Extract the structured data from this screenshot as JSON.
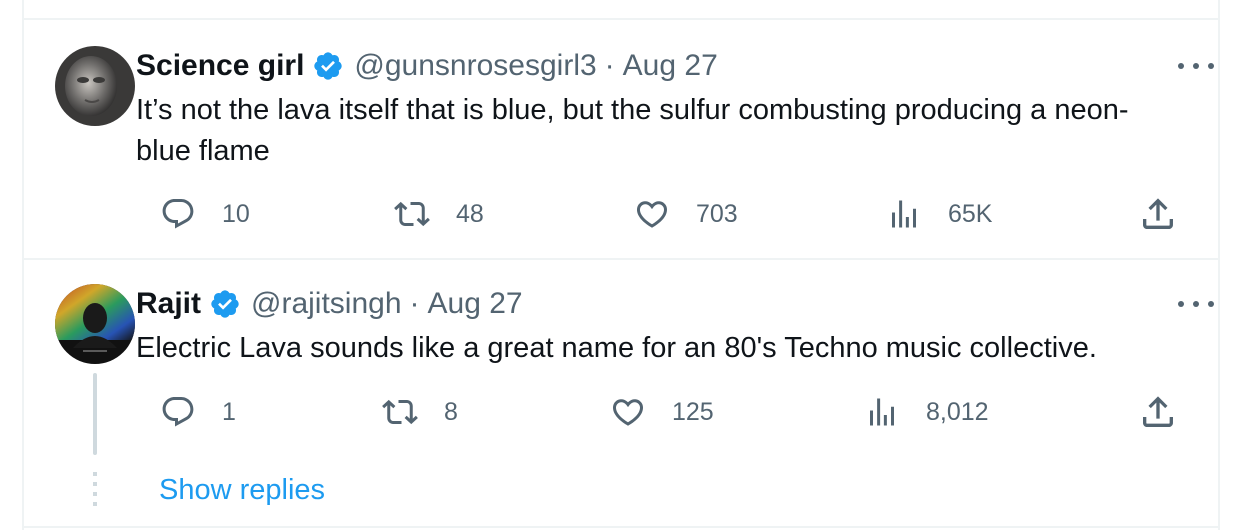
{
  "colors": {
    "accent": "#1d9bf0",
    "text_primary": "#0f1419",
    "text_secondary": "#536471",
    "divider": "#eff3f4"
  },
  "tweets": [
    {
      "name": "Science girl",
      "handle": "@gunsnrosesgirl3",
      "separator": "·",
      "date": "Aug 27",
      "verified": true,
      "text": "It’s not the lava itself that is blue, but the sulfur combusting producing a neon-blue flame",
      "replies": "10",
      "retweets": "48",
      "likes": "703",
      "views": "65K",
      "icons": [
        "reply-icon",
        "retweet-icon",
        "like-icon",
        "views-icon",
        "share-icon",
        "more-icon"
      ]
    },
    {
      "name": "Rajit",
      "handle": "@rajitsingh",
      "separator": "·",
      "date": "Aug 27",
      "verified": true,
      "text": "Electric Lava sounds like a great name for an 80's Techno music collective.",
      "replies": "1",
      "retweets": "8",
      "likes": "125",
      "views": "8,012",
      "icons": [
        "reply-icon",
        "retweet-icon",
        "like-icon",
        "views-icon",
        "share-icon",
        "more-icon"
      ]
    }
  ],
  "show_replies_label": "Show replies"
}
